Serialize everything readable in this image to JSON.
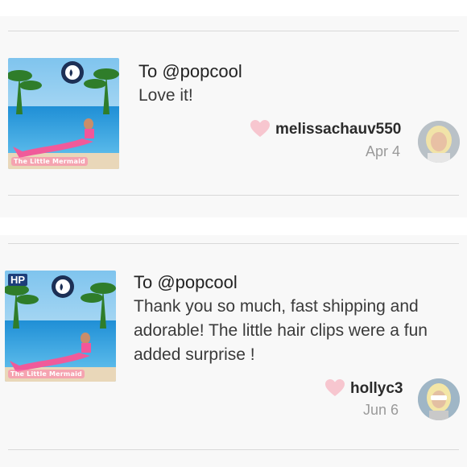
{
  "reviews": [
    {
      "to_label": "To @popcool",
      "text": "Love it!",
      "username": "melissachauv550",
      "date": "Apr 4",
      "thumbnail": {
        "caption": "The Little Mermaid",
        "icon": "mermaid-tail-product-icon"
      },
      "avatar_icon": "user-avatar"
    },
    {
      "to_label": "To @popcool",
      "text": "Thank you so much, fast shipping and adorable! The little hair clips were a fun added surprise !",
      "username": "hollyc3",
      "date": "Jun 6",
      "thumbnail": {
        "badge": "HP",
        "caption": "The Little Mermaid",
        "icon": "mermaid-tail-product-icon"
      },
      "avatar_icon": "user-avatar"
    }
  ],
  "colors": {
    "heart": "#f7c6cf",
    "card_background": "#f8f8f8",
    "divider": "#d9d9d9",
    "date": "#9a9a9a"
  }
}
